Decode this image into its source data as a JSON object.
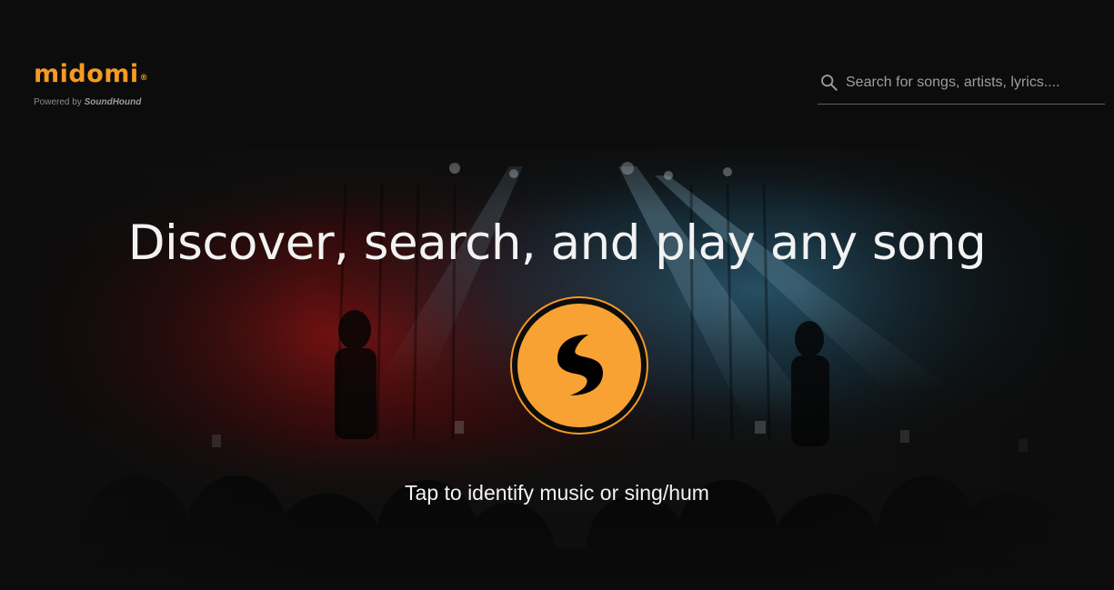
{
  "header": {
    "logo": {
      "wordmark": "midomi",
      "registered": "®",
      "powered_prefix": "Powered by",
      "powered_brand": "SoundHound"
    },
    "search": {
      "placeholder": "Search for songs, artists, lyrics....",
      "value": "",
      "icon": "search-icon"
    }
  },
  "hero": {
    "title": "Discover, search, and play any song",
    "button_icon": "soundhound-icon",
    "caption": "Tap to identify music or sing/hum",
    "background": "concert-stage-photo"
  },
  "colors": {
    "brand_orange": "#f59a23",
    "page_background": "#0c0c0c",
    "text_primary": "#f2f2f2"
  }
}
